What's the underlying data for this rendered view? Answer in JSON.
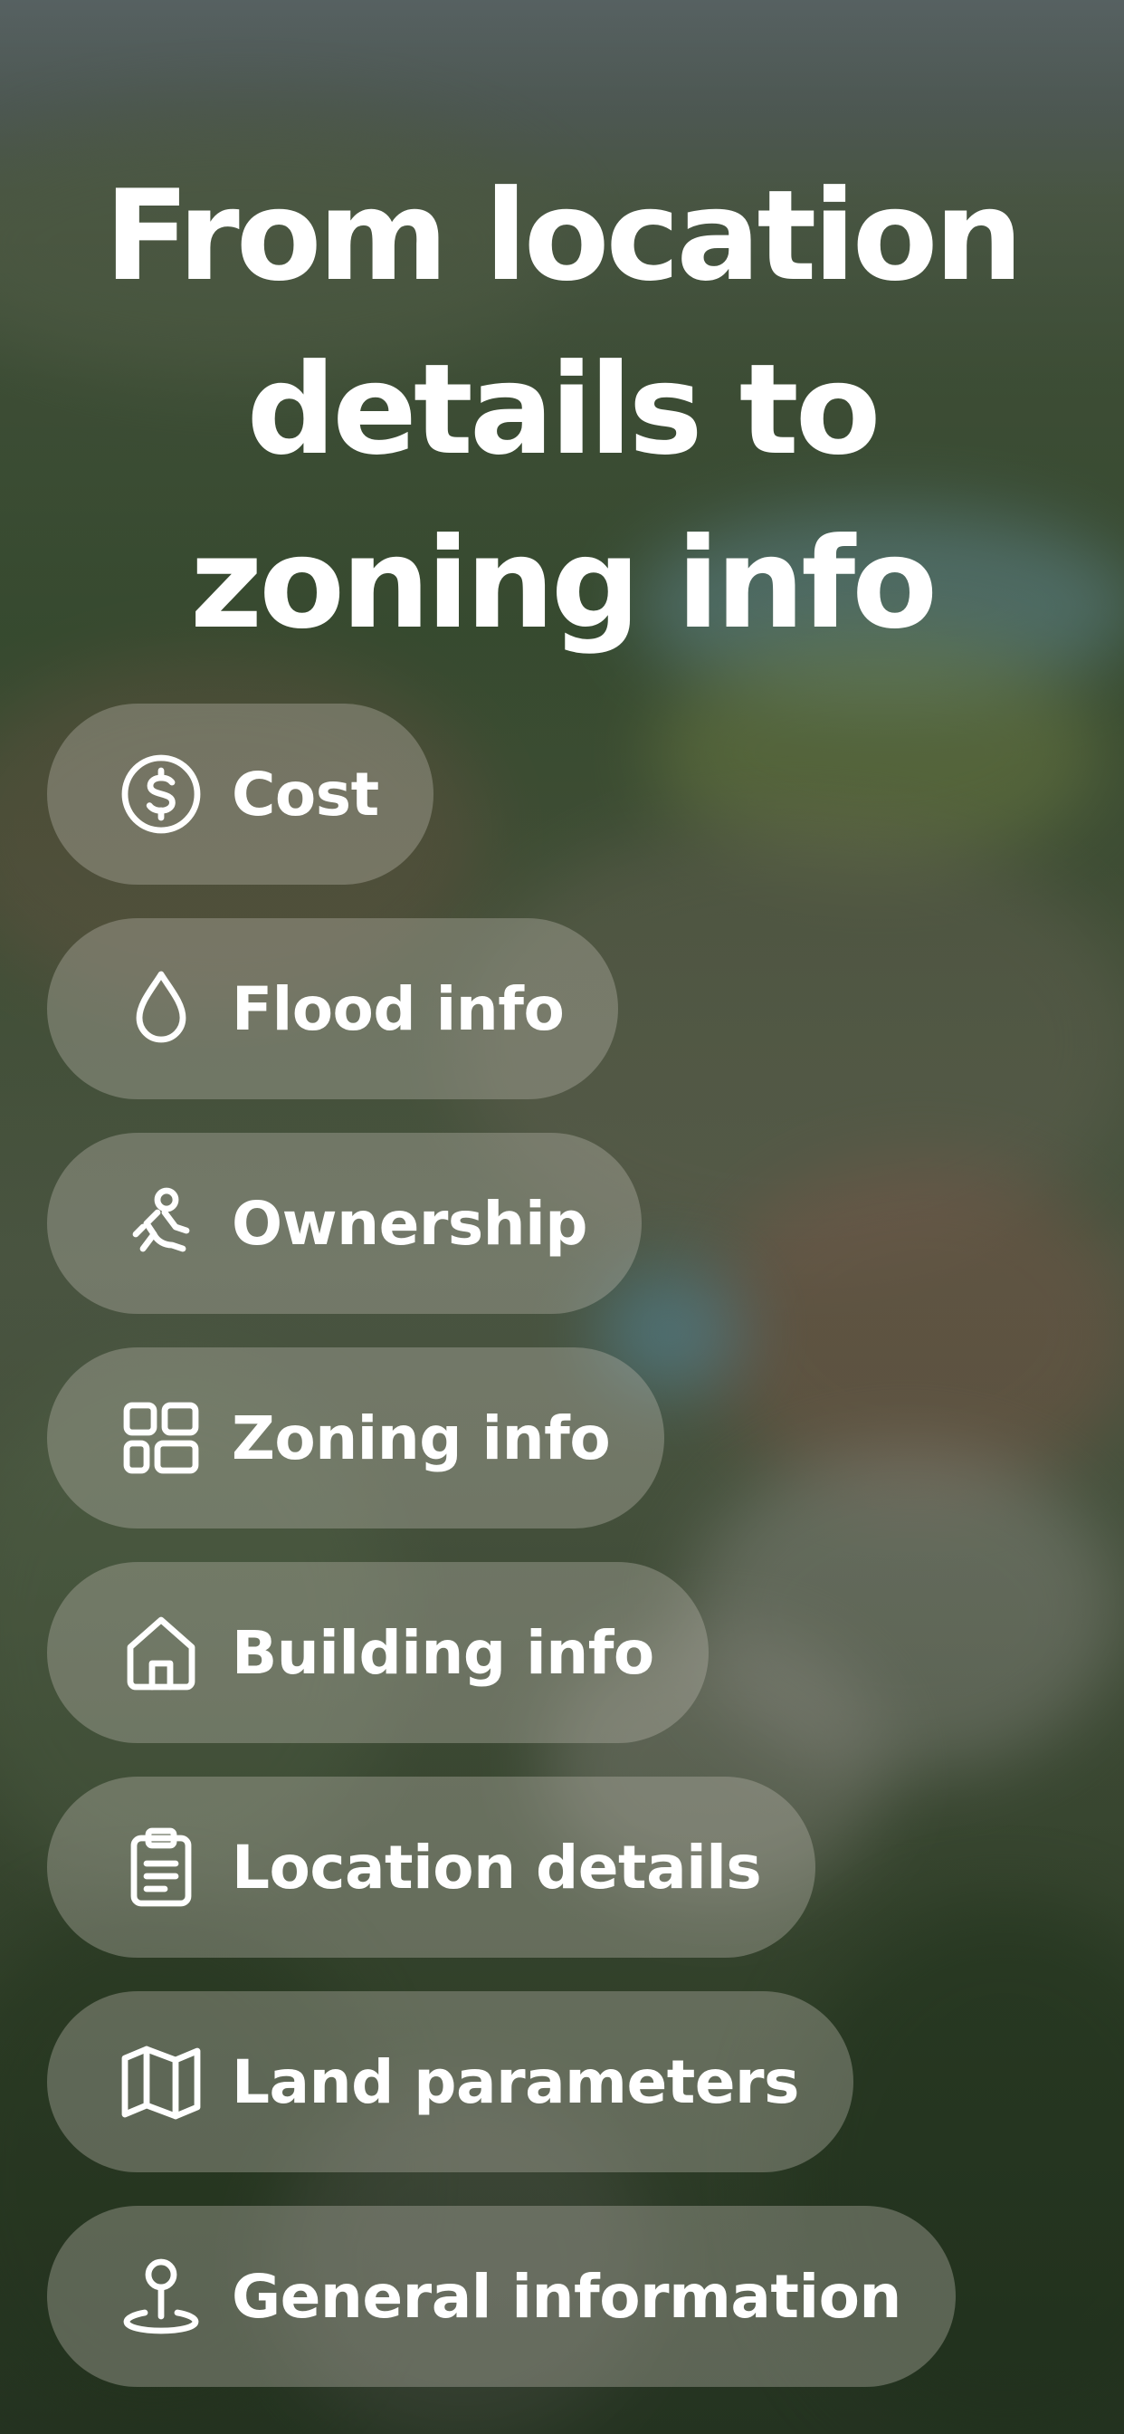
{
  "headline": {
    "line1": "From location",
    "line2": "details to",
    "line3": "zoning info"
  },
  "features": [
    {
      "label": "Cost",
      "icon": "dollar-icon"
    },
    {
      "label": "Flood info",
      "icon": "water-drop-icon"
    },
    {
      "label": "Ownership",
      "icon": "handshake-icon"
    },
    {
      "label": "Zoning info",
      "icon": "grid-layout-icon"
    },
    {
      "label": "Building info",
      "icon": "house-icon"
    },
    {
      "label": "Location details",
      "icon": "clipboard-icon"
    },
    {
      "label": "Land parameters",
      "icon": "map-icon"
    },
    {
      "label": "General information",
      "icon": "location-pin-icon"
    }
  ]
}
